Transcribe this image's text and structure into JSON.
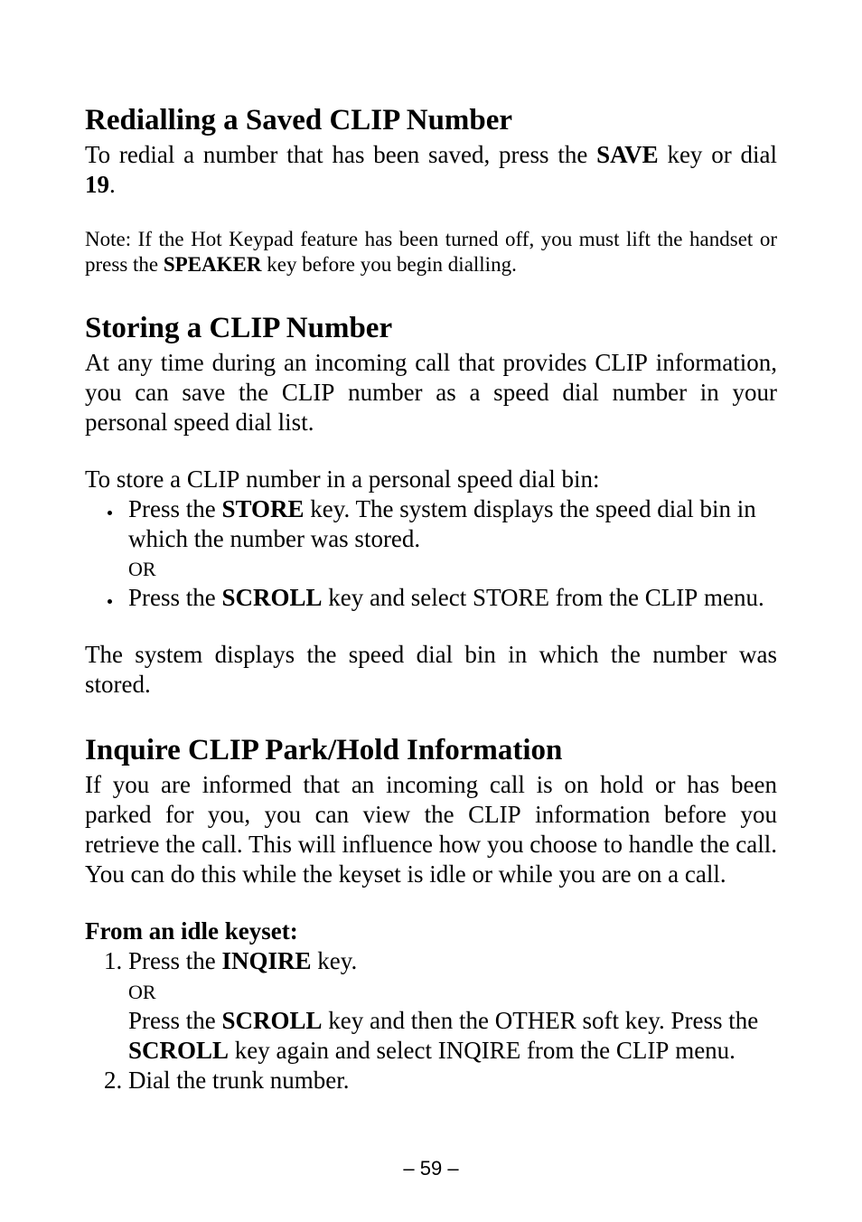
{
  "page_number_display": "– 59 –",
  "section1": {
    "heading": "Redialling a Saved CLIP Number",
    "p1_a": "To redial a number that has been saved, press the ",
    "save_key": "SAVE",
    "p1_b": " key or dial ",
    "dial_code": "19",
    "p1_c": ".",
    "note_a": "Note: If the Hot Keypad feature has been turned off, you must lift the handset or press the ",
    "speaker_key": "SPEAKER",
    "note_b": " key before you begin dialling."
  },
  "section2": {
    "heading": "Storing a CLIP Number",
    "p1_a": "At any time during an incoming call that provides ",
    "clip1": "CLIP",
    "p1_b": " information, you can save the ",
    "clip2": "CLIP",
    "p1_c": " number as a speed dial number in your personal speed dial list.",
    "p2_a": "To store a ",
    "clip3": "CLIP",
    "p2_b": " number in a personal speed dial bin:",
    "bullet1_a": "Press the ",
    "store_key": "STORE",
    "bullet1_b": " key. The system displays the speed dial bin in which the number was stored.",
    "or1": "OR",
    "bullet2_a": "Press the ",
    "scroll_key": "SCROLL",
    "bullet2_b": " key and select ",
    "store2": "STORE",
    "bullet2_c": " from the ",
    "clip4": "CLIP",
    "bullet2_d": " menu.",
    "p3": "The system displays the speed dial bin in which the number was stored."
  },
  "section3": {
    "heading": "Inquire CLIP Park/Hold Information",
    "p1_a": "If you are informed that an incoming call is on hold or has been parked for you, you can view the ",
    "clip1": "CLIP",
    "p1_b": " information before you retrieve the call. This will influence how you choose to handle the call. You can do this while the keyset is idle or while you are on a call.",
    "subhead": "From an idle keyset:",
    "ol1_a": "Press the ",
    "inqire_key": "INQIRE",
    "ol1_b": " key.",
    "or1": "OR",
    "ol1_c": "Press the ",
    "scroll1": "SCROLL",
    "ol1_d": " key and then the ",
    "other": "OTHER",
    "ol1_e": " soft key. Press the ",
    "scroll2": "SCROLL",
    "ol1_f": " key again and select ",
    "inqire2": "INQIRE",
    "ol1_g": " from the ",
    "clip2": "CLIP",
    "ol1_h": " menu.",
    "ol2": "Dial the trunk number."
  }
}
